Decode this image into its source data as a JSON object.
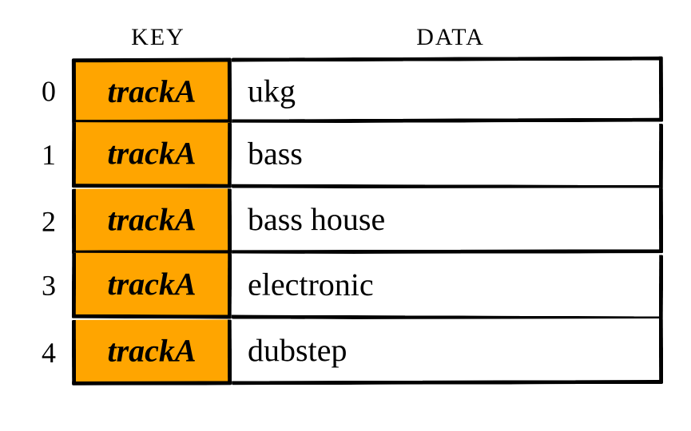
{
  "headers": {
    "key": "KEY",
    "data": "DATA"
  },
  "rows": [
    {
      "index": "0",
      "key": "trackA",
      "data": "ukg"
    },
    {
      "index": "1",
      "key": "trackA",
      "data": "bass"
    },
    {
      "index": "2",
      "key": "trackA",
      "data": "bass house"
    },
    {
      "index": "3",
      "key": "trackA",
      "data": "electronic"
    },
    {
      "index": "4",
      "key": "trackA",
      "data": "dubstep"
    }
  ],
  "colors": {
    "key_fill": "#ffa500",
    "border": "#000000",
    "bg": "#ffffff"
  }
}
